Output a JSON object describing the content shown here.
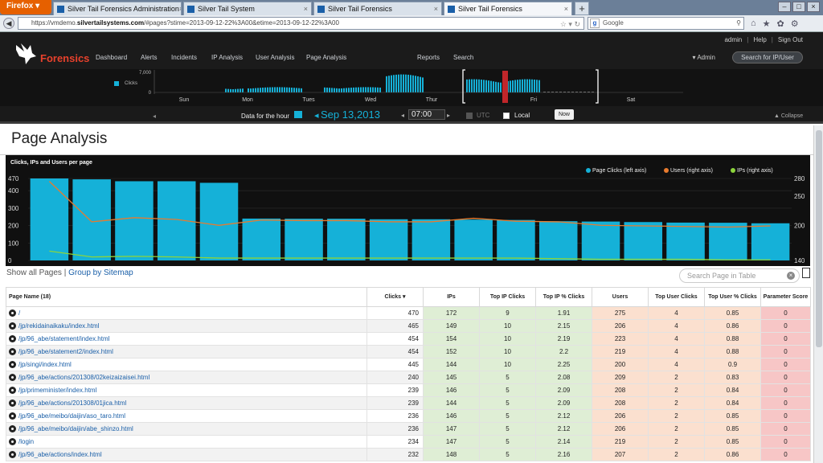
{
  "browser": {
    "menu_label": "Firefox ▾",
    "tabs": [
      {
        "title": "Silver Tail Forensics Administration",
        "active": false
      },
      {
        "title": "Silver Tail System",
        "active": false
      },
      {
        "title": "Silver Tail Forensics",
        "active": false
      },
      {
        "title": "Silver Tail Forensics",
        "active": true
      }
    ],
    "new_tab": "+",
    "url_prefix": "https://vmdemo.",
    "url_host": "silvertailsystems.com",
    "url_rest": "/#pages?stime=2013-09-12-22%3A00&etime=2013-09-12-22%3A00",
    "search_engine": "Google",
    "search_placeholder": "Google"
  },
  "app": {
    "brand": "Forensics",
    "nav": [
      "Dashboard",
      "Alerts",
      "Incidents",
      "IP Analysis",
      "User Analysis",
      "Page Analysis",
      "Reports",
      "Search"
    ],
    "top_links": [
      "admin",
      "Help",
      "Sign Out"
    ],
    "admin_menu": "▾ Admin",
    "search_button": "Search for IP/User"
  },
  "timeline": {
    "legend": "Clicks",
    "y_top": "7,000",
    "y_bottom": "0",
    "days": [
      "Sun",
      "Mon",
      "Tues",
      "Wed",
      "Thur",
      "Fri",
      "Sat"
    ]
  },
  "datebar": {
    "label": "Data for the hour",
    "month_day": "Sep 13,",
    "year": "2013",
    "time": "07:00",
    "utc": "UTC",
    "local": "Local",
    "now_button": "Now",
    "collapse": "▲ Collapse"
  },
  "page": {
    "title": "Page Analysis"
  },
  "chart_data": {
    "type": "bar",
    "title": "Clicks, IPs and Users per page",
    "series": [
      {
        "name": "Page Clicks (left axis)",
        "color": "#15b1d8",
        "axis": "left",
        "values": [
          470,
          465,
          454,
          454,
          445,
          240,
          239,
          239,
          236,
          236,
          234,
          232,
          225,
          223,
          220,
          217,
          216,
          213
        ]
      },
      {
        "name": "Users (right axis)",
        "color": "#e87b2e",
        "axis": "right",
        "values": [
          275,
          206,
          213,
          210,
          200,
          209,
          208,
          208,
          206,
          206,
          212,
          207,
          206,
          200,
          199,
          198,
          197,
          199
        ]
      },
      {
        "name": "IPs (right axis)",
        "color": "#8cd43c",
        "axis": "right",
        "values": [
          156,
          146,
          147,
          146,
          144,
          144,
          144,
          144,
          144,
          144,
          144,
          144,
          143,
          142,
          142,
          142,
          141,
          141
        ]
      }
    ],
    "left_axis": {
      "min": 0,
      "max": 470,
      "ticks": [
        "470",
        "400",
        "300",
        "200",
        "100",
        "0"
      ]
    },
    "right_axis": {
      "min": 140,
      "max": 280,
      "ticks": [
        "280",
        "250",
        "200",
        "140"
      ]
    },
    "legend_position": "top-right",
    "grid": true
  },
  "table": {
    "show_all": "Show all Pages",
    "group_by": "Group by Sitemap",
    "search_placeholder": "Search Page in Table",
    "columns": [
      "Page Name (18)",
      "Clicks ▾",
      "IPs",
      "Top IP Clicks",
      "Top IP % Clicks",
      "Users",
      "Top User Clicks",
      "Top User % Clicks",
      "Parameter Score"
    ],
    "rows": [
      [
        "/",
        "470",
        "172",
        "9",
        "1.91",
        "275",
        "4",
        "0.85",
        "0"
      ],
      [
        "/jp/rekidainaikaku/index.html",
        "465",
        "149",
        "10",
        "2.15",
        "206",
        "4",
        "0.86",
        "0"
      ],
      [
        "/jp/96_abe/statement/index.html",
        "454",
        "154",
        "10",
        "2.19",
        "223",
        "4",
        "0.88",
        "0"
      ],
      [
        "/jp/96_abe/statement2/index.html",
        "454",
        "152",
        "10",
        "2.2",
        "219",
        "4",
        "0.88",
        "0"
      ],
      [
        "/jp/singi/index.html",
        "445",
        "144",
        "10",
        "2.25",
        "200",
        "4",
        "0.9",
        "0"
      ],
      [
        "/jp/96_abe/actions/201308/02keizaizaisei.html",
        "240",
        "145",
        "5",
        "2.08",
        "209",
        "2",
        "0.83",
        "0"
      ],
      [
        "/jp/primeminister/index.html",
        "239",
        "146",
        "5",
        "2.09",
        "208",
        "2",
        "0.84",
        "0"
      ],
      [
        "/jp/96_abe/actions/201308/01jica.html",
        "239",
        "144",
        "5",
        "2.09",
        "208",
        "2",
        "0.84",
        "0"
      ],
      [
        "/jp/96_abe/meibo/daijin/aso_taro.html",
        "236",
        "146",
        "5",
        "2.12",
        "206",
        "2",
        "0.85",
        "0"
      ],
      [
        "/jp/96_abe/meibo/daijin/abe_shinzo.html",
        "236",
        "147",
        "5",
        "2.12",
        "206",
        "2",
        "0.85",
        "0"
      ],
      [
        "/login",
        "234",
        "147",
        "5",
        "2.14",
        "219",
        "2",
        "0.85",
        "0"
      ],
      [
        "/jp/96_abe/actions/index.html",
        "232",
        "148",
        "5",
        "2.16",
        "207",
        "2",
        "0.86",
        "0"
      ]
    ]
  }
}
